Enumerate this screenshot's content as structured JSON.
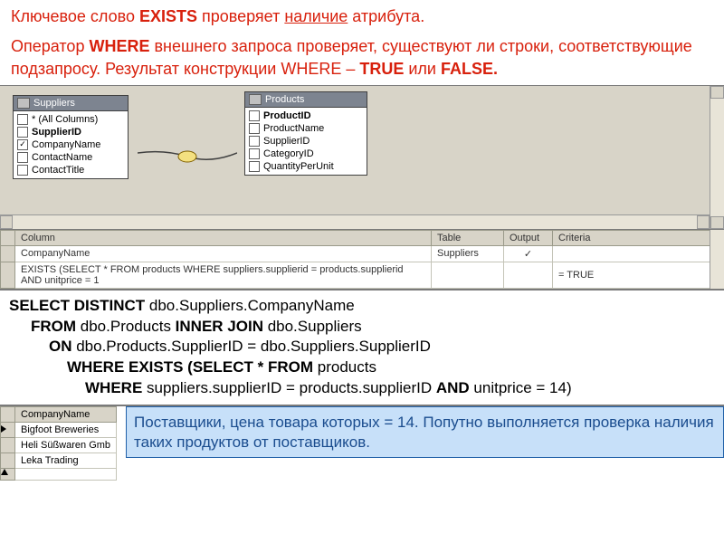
{
  "intro": {
    "line1_pre": "Ключевое слово ",
    "line1_kw": "EXISTS",
    "line1_mid": " проверяет ",
    "line1_u": "наличие",
    "line1_post": " атрибута.",
    "line2_pre": "Оператор ",
    "line2_kw": "WHERE",
    "line2_mid": " внешнего запроса проверяет, существуют ли строки, соответствующие подзапросу. Результат конструкции WHERE – ",
    "line2_kw2": "TRUE",
    "line2_or": " или ",
    "line2_kw3": "FALSE."
  },
  "designer": {
    "suppliers": {
      "title": "Suppliers",
      "fields": [
        {
          "label": "* (All Columns)",
          "checked": false
        },
        {
          "label": "SupplierID",
          "checked": false,
          "bold": true
        },
        {
          "label": "CompanyName",
          "checked": true
        },
        {
          "label": "ContactName",
          "checked": false
        },
        {
          "label": "ContactTitle",
          "checked": false
        }
      ]
    },
    "products": {
      "title": "Products",
      "fields": [
        {
          "label": "ProductID",
          "checked": false,
          "bold": true
        },
        {
          "label": "ProductName",
          "checked": false
        },
        {
          "label": "SupplierID",
          "checked": false
        },
        {
          "label": "CategoryID",
          "checked": false
        },
        {
          "label": "QuantityPerUnit",
          "checked": false
        }
      ]
    }
  },
  "criteria_grid": {
    "headers": {
      "col": "Column",
      "table": "Table",
      "output": "Output",
      "criteria": "Criteria"
    },
    "rows": [
      {
        "column": "CompanyName",
        "table": "Suppliers",
        "output": "✓",
        "criteria": ""
      },
      {
        "column": "EXISTS (SELECT * FROM products WHERE suppliers.supplierid = products.supplierid AND unitprice = 1",
        "table": "",
        "output": "",
        "criteria": "= TRUE"
      }
    ]
  },
  "sql": {
    "t1": "SELECT DISTINCT",
    "t2": " dbo.Suppliers.CompanyName",
    "t3": "FROM",
    "t4": " dbo.Products ",
    "t5": "INNER JOIN",
    "t6": " dbo.Suppliers",
    "t7": "ON",
    "t8": " dbo.Products.SupplierID = dbo.Suppliers.SupplierID",
    "t9": "WHERE EXISTS (SELECT * FROM",
    "t10": " products",
    "t11": "WHERE",
    "t12": " suppliers.supplierID = products.supplierID ",
    "t13": "AND",
    "t14": " unitprice = 14)"
  },
  "results": {
    "header": "CompanyName",
    "rows": [
      "Bigfoot Breweries",
      "Heli Süßwaren Gmb",
      "Leka Trading"
    ]
  },
  "note": "Поставщики, цена товара которых = 14. Попутно выполняется проверка наличия таких продуктов от поставщиков."
}
